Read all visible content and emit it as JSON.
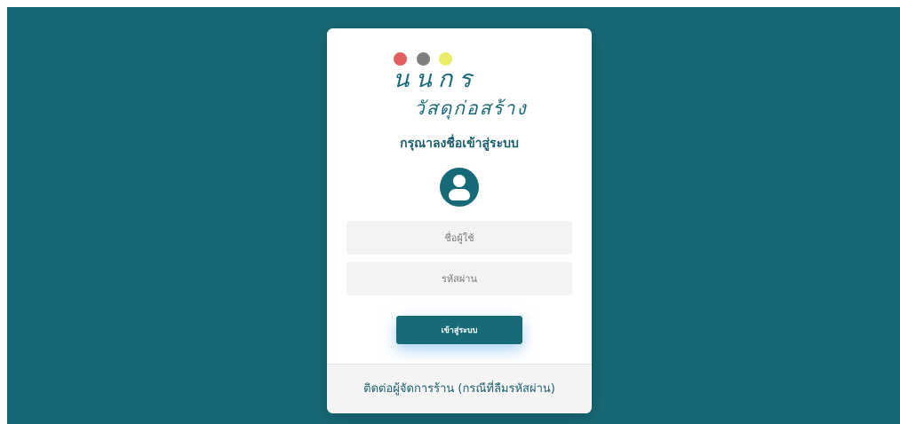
{
  "brand": {
    "name": "นนกร",
    "subtitle": "วัสดุก่อสร้าง",
    "dot_colors": [
      "#e25f5f",
      "#7f7f7f",
      "#e8ee6a"
    ]
  },
  "login": {
    "title": "กรุณาลงชื่อเข้าสู่ระบบ",
    "avatar_icon": "user-circle-icon",
    "username_placeholder": "ชื่อผู้ใช้",
    "password_placeholder": "รหัสผ่าน",
    "submit_label": "เข้าสู่ระบบ"
  },
  "footer": {
    "contact_link": "ติดต่อผู้จัดการร้าน (กรณีที่ลืมรหัสผ่าน)"
  },
  "colors": {
    "background": "#176876",
    "accent": "#176a78",
    "card": "#ffffff"
  }
}
